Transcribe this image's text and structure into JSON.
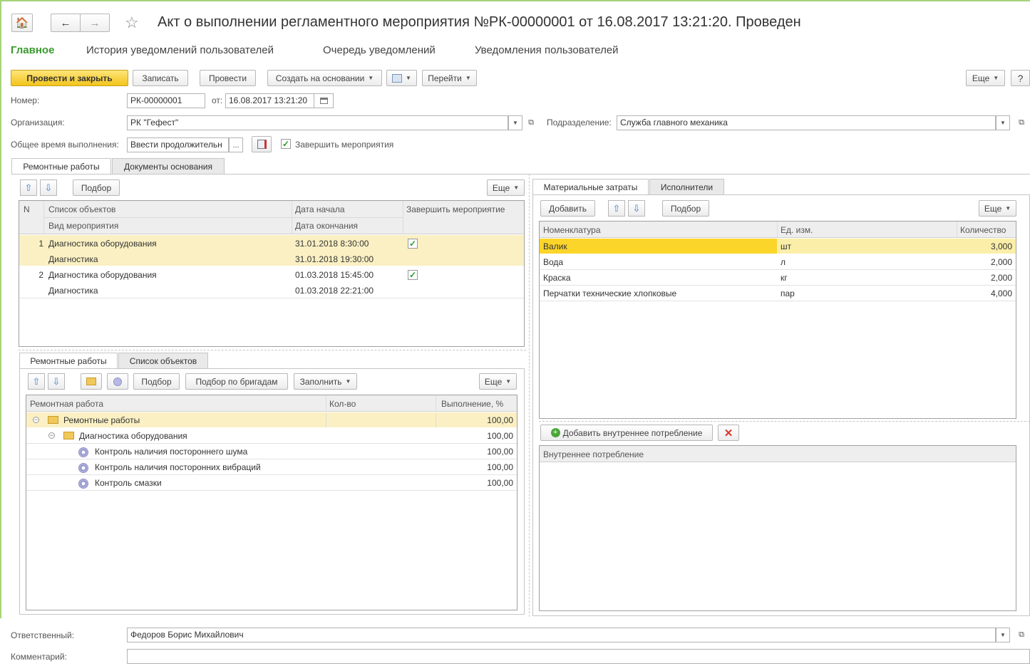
{
  "window": {
    "title": "Акт о выполнении регламентного мероприятия №РК-00000001 от 16.08.2017 13:21:20. Проведен",
    "nav_home": "🏠",
    "nav_back": "←",
    "nav_forward": "→",
    "favorite": "☆"
  },
  "top_tabs": [
    {
      "label": "Главное",
      "active": true
    },
    {
      "label": "История уведомлений пользователей"
    },
    {
      "label": "Очередь уведомлений"
    },
    {
      "label": "Уведомления пользователей"
    }
  ],
  "toolbar": {
    "post_close": "Провести и закрыть",
    "write": "Записать",
    "post": "Провести",
    "create_based": "Создать на основании",
    "goto": "Перейти",
    "more": "Еще",
    "help": "?"
  },
  "form": {
    "number_label": "Номер:",
    "number_value": "РК-00000001",
    "date_label": "от:",
    "date_value": "16.08.2017 13:21:20",
    "org_label": "Организация:",
    "org_value": "РК \"Гефест\"",
    "dept_label": "Подразделение:",
    "dept_value": "Служба главного механика",
    "duration_label": "Общее время выполнения:",
    "duration_value": "Ввести продолжительн",
    "complete_label": "Завершить мероприятия",
    "complete_checked": true,
    "responsible_label": "Ответственный:",
    "responsible_value": "Федоров Борис Михайлович",
    "comment_label": "Комментарий:",
    "comment_value": ""
  },
  "left_tabs": [
    "Ремонтные работы",
    "Документы основания"
  ],
  "objects_table": {
    "select_button": "Подбор",
    "more": "Еще",
    "headers": {
      "n": "N",
      "objects": "Список объектов",
      "event_type": "Вид мероприятия",
      "start": "Дата начала",
      "end": "Дата окончания",
      "complete": "Завершить мероприятие"
    },
    "rows": [
      {
        "n": "1",
        "object": "Диагностика оборудования",
        "type": "Диагностика",
        "start": "31.01.2018 8:30:00",
        "end": "31.01.2018 19:30:00",
        "complete": true
      },
      {
        "n": "2",
        "object": "Диагностика оборудования",
        "type": "Диагностика",
        "start": "01.03.2018 15:45:00",
        "end": "01.03.2018 22:21:00",
        "complete": true
      }
    ]
  },
  "work_tabs": [
    "Ремонтные работы",
    "Список объектов"
  ],
  "work_table": {
    "select": "Подбор",
    "select_brigades": "Подбор по бригадам",
    "fill": "Заполнить",
    "more": "Еще",
    "headers": {
      "work": "Ремонтная работа",
      "qty": "Кол-во",
      "percent": "Выполнение, %"
    },
    "rows": [
      {
        "name": "Ремонтные работы",
        "percent": "100,00",
        "level": 0
      },
      {
        "name": "Диагностика оборудования",
        "percent": "100,00",
        "level": 1
      },
      {
        "name": "Контроль наличия постороннего шума",
        "percent": "100,00",
        "level": 2
      },
      {
        "name": "Контроль наличия посторонних вибраций",
        "percent": "100,00",
        "level": 2
      },
      {
        "name": "Контроль смазки",
        "percent": "100,00",
        "level": 2
      }
    ]
  },
  "right_tabs": [
    "Материальные затраты",
    "Исполнители"
  ],
  "materials": {
    "add": "Добавить",
    "select": "Подбор",
    "more": "Еще",
    "headers": {
      "name": "Номенклатура",
      "unit": "Ед. изм.",
      "qty": "Количество"
    },
    "rows": [
      {
        "name": "Валик",
        "unit": "шт",
        "qty": "3,000"
      },
      {
        "name": "Вода",
        "unit": "л",
        "qty": "2,000"
      },
      {
        "name": "Краска",
        "unit": "кг",
        "qty": "2,000"
      },
      {
        "name": "Перчатки технические хлопковые",
        "unit": "пар",
        "qty": "4,000"
      }
    ]
  },
  "internal": {
    "add": "Добавить внутреннее потребление",
    "header": "Внутреннее потребление"
  },
  "colors": {
    "accent_green": "#3a9a2e",
    "primary_button": "#f2c41c",
    "row_highlight": "#fcd52a",
    "row_selected": "#fbf0c3"
  }
}
